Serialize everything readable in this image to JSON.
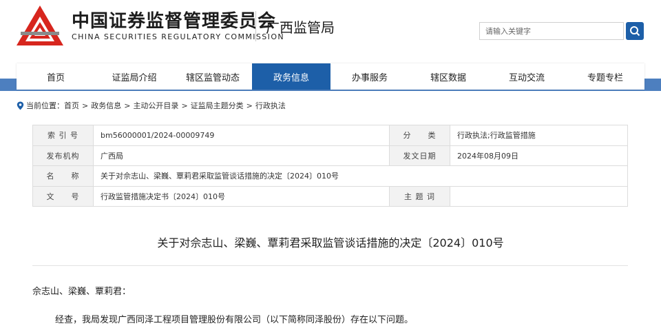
{
  "header": {
    "org_name_cn": "中国证券监督管理委员会",
    "org_name_en": "CHINA SECURITIES REGULATORY COMMISSION",
    "bureau": "广西监管局",
    "search_placeholder": "请输入关键字",
    "logo_colors": {
      "red": "#d7261e",
      "gray": "#8a8a8a"
    }
  },
  "nav": {
    "items": [
      {
        "label": "首页"
      },
      {
        "label": "证监局介绍"
      },
      {
        "label": "辖区监管动态"
      },
      {
        "label": "政务信息"
      },
      {
        "label": "办事服务"
      },
      {
        "label": "辖区数据"
      },
      {
        "label": "互动交流"
      },
      {
        "label": "专题专栏"
      }
    ],
    "active_label": "政务信息",
    "accent": "#1d5fa8"
  },
  "breadcrumb": {
    "prefix": "当前位置：",
    "items": [
      "首页",
      "政务信息",
      "主动公开目录",
      "证监局主题分类",
      "行政执法"
    ],
    "separator": ">"
  },
  "meta": {
    "index_label": "索 引 号",
    "index_value": "bm56000001/2024-00009749",
    "category_label": "分　　类",
    "category_value": "行政执法;行政监管措施",
    "publisher_label": "发布机构",
    "publisher_value": "广西局",
    "date_label": "发文日期",
    "date_value": "2024年08月09日",
    "name_label": "名　　称",
    "name_value": "关于对佘志山、梁巍、覃莉君采取监管谈话措施的决定〔2024〕010号",
    "docno_label": "文　　号",
    "docno_value": "行政监管措施决定书〔2024〕010号",
    "keywords_label": "主 题 词",
    "keywords_value": ""
  },
  "article": {
    "title": "关于对佘志山、梁巍、覃莉君采取监管谈话措施的决定〔2024〕010号",
    "salutation": "佘志山、梁巍、覃莉君：",
    "para1": "经查，我局发现广西同泽工程项目管理股份有限公司（以下简称同泽股份）存在以下问题。"
  }
}
